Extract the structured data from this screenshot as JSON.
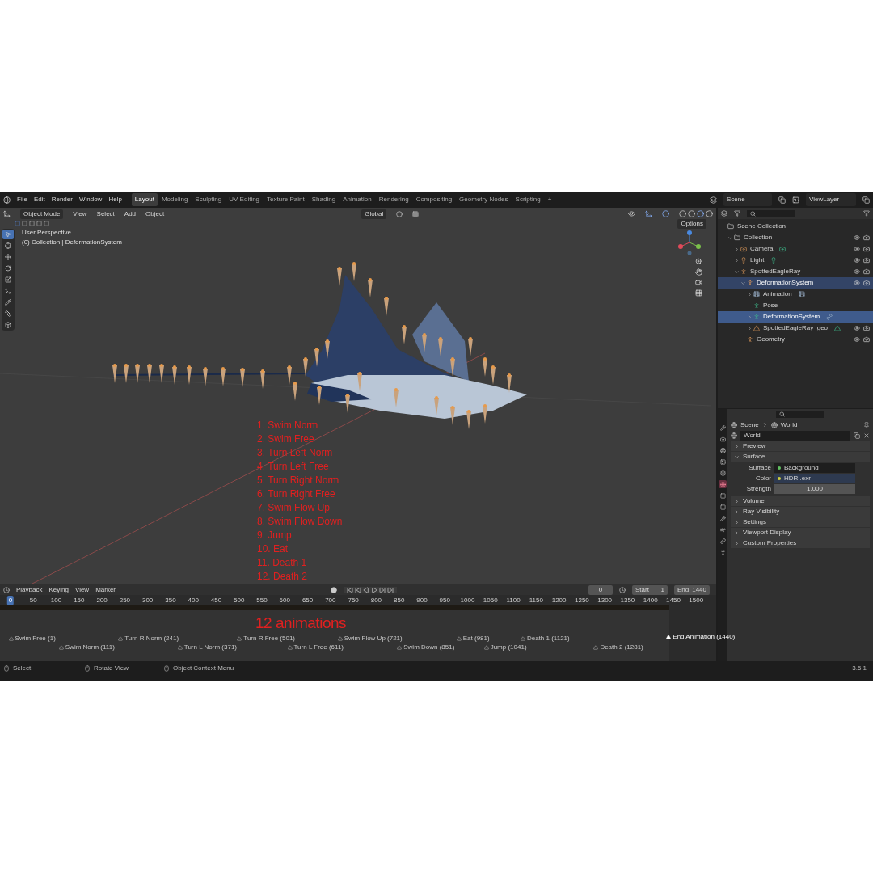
{
  "top_bar": {
    "menus": [
      "File",
      "Edit",
      "Render",
      "Window",
      "Help"
    ],
    "workspace_tabs": [
      {
        "label": "Layout",
        "selected": true
      },
      {
        "label": "Modeling",
        "selected": false
      },
      {
        "label": "Sculpting",
        "selected": false
      },
      {
        "label": "UV Editing",
        "selected": false
      },
      {
        "label": "Texture Paint",
        "selected": false
      },
      {
        "label": "Shading",
        "selected": false
      },
      {
        "label": "Animation",
        "selected": false
      },
      {
        "label": "Rendering",
        "selected": false
      },
      {
        "label": "Compositing",
        "selected": false
      },
      {
        "label": "Geometry Nodes",
        "selected": false
      },
      {
        "label": "Scripting",
        "selected": false
      }
    ],
    "add_tab": "+",
    "scene": "Scene",
    "view_layer": "ViewLayer"
  },
  "viewport": {
    "mode": "Object Mode",
    "menus": [
      "View",
      "Select",
      "Add",
      "Object"
    ],
    "orientation": "Global",
    "options": "Options",
    "overlay_title": "User Perspective",
    "overlay_subtitle": "(0) Collection | DeformationSystem",
    "tools": [
      {
        "kind": "select",
        "selected": true
      },
      {
        "kind": "cursor",
        "selected": false
      },
      {
        "kind": "move",
        "selected": false
      },
      {
        "kind": "rotate",
        "selected": false
      },
      {
        "kind": "scale",
        "selected": false
      },
      {
        "kind": "transform",
        "selected": false
      },
      {
        "kind": "annotate",
        "selected": false
      },
      {
        "kind": "measure",
        "selected": false
      },
      {
        "kind": "add-cube",
        "selected": false
      }
    ],
    "annotation_list": [
      "1. Swim Norm",
      "2. Swim Free",
      "3. Turn Left Norm",
      "4. Turn Left Free",
      "5. Turn Right Norm",
      "6. Turn Right Free",
      "7. Swim Flow Up",
      "8. Swim Flow Down",
      "9. Jump",
      "10. Eat",
      "11. Death 1",
      "12. Death 2"
    ]
  },
  "outliner": {
    "items": [
      {
        "label": "Scene Collection",
        "kind": "scene-collection",
        "selected": false,
        "children": [
          {
            "label": "Collection",
            "kind": "collection",
            "selected": false,
            "expanded": true,
            "visible": true,
            "children": [
              {
                "label": "Camera",
                "kind": "camera",
                "selected": false,
                "expanded": false,
                "visible": true
              },
              {
                "label": "Light",
                "kind": "light",
                "selected": false,
                "expanded": false,
                "visible": true
              },
              {
                "label": "SpottedEagleRay",
                "kind": "armature",
                "selected": false,
                "expanded": true,
                "visible": true,
                "children": [
                  {
                    "label": "DeformationSystem",
                    "kind": "armature",
                    "selected": true,
                    "expanded": true,
                    "visible": true,
                    "children": [
                      {
                        "label": "Animation",
                        "kind": "animation",
                        "selected": false,
                        "expanded": false
                      },
                      {
                        "label": "Pose",
                        "kind": "pose",
                        "selected": false
                      },
                      {
                        "label": "DeformationSystem",
                        "kind": "armature-data",
                        "selected": true,
                        "active": true,
                        "expanded": false
                      },
                      {
                        "label": "SpottedEagleRay_geo",
                        "kind": "mesh",
                        "selected": false,
                        "expanded": false,
                        "visible": true
                      }
                    ]
                  },
                  {
                    "label": "Geometry",
                    "kind": "armature",
                    "selected": false,
                    "visible": true
                  }
                ]
              }
            ]
          }
        ]
      }
    ]
  },
  "properties": {
    "tabs": [
      {
        "kind": "tool",
        "selected": false
      },
      {
        "kind": "render",
        "selected": false
      },
      {
        "kind": "output",
        "selected": false
      },
      {
        "kind": "view-layer",
        "selected": false
      },
      {
        "kind": "scene",
        "selected": false
      },
      {
        "kind": "world",
        "selected": true
      },
      {
        "kind": "collection",
        "selected": false
      },
      {
        "kind": "object",
        "selected": false
      },
      {
        "kind": "modifiers",
        "selected": false
      },
      {
        "kind": "physics",
        "selected": false
      },
      {
        "kind": "constraints",
        "selected": false
      },
      {
        "kind": "data",
        "selected": false
      }
    ],
    "breadcrumb": [
      "Scene",
      "World"
    ],
    "world_name": "World",
    "panels": [
      {
        "label": "Preview",
        "expanded": false
      },
      {
        "label": "Surface",
        "expanded": true,
        "fields": [
          {
            "label": "Surface",
            "value": "Background",
            "kind": "link"
          },
          {
            "label": "Color",
            "value": "HDRI.exr",
            "kind": "texture"
          },
          {
            "label": "Strength",
            "value": "1.000",
            "kind": "number"
          }
        ]
      },
      {
        "label": "Volume",
        "expanded": false
      },
      {
        "label": "Ray Visibility",
        "expanded": false
      },
      {
        "label": "Settings",
        "expanded": false
      },
      {
        "label": "Viewport Display",
        "expanded": false
      },
      {
        "label": "Custom Properties",
        "expanded": false
      }
    ]
  },
  "timeline": {
    "menus": [
      "Playback",
      "Keying",
      "View",
      "Marker"
    ],
    "current_frame": "0",
    "start_label": "Start",
    "start": "1",
    "end_label": "End",
    "end": "1440",
    "ruler": [
      {
        "label": "0",
        "selected": true
      },
      {
        "label": "50",
        "selected": false
      },
      {
        "label": "100",
        "selected": false
      },
      {
        "label": "150",
        "selected": false
      },
      {
        "label": "200",
        "selected": false
      },
      {
        "label": "250",
        "selected": false
      },
      {
        "label": "300",
        "selected": false
      },
      {
        "label": "350",
        "selected": false
      },
      {
        "label": "400",
        "selected": false
      },
      {
        "label": "450",
        "selected": false
      },
      {
        "label": "500",
        "selected": false
      },
      {
        "label": "550",
        "selected": false
      },
      {
        "label": "600",
        "selected": false
      },
      {
        "label": "650",
        "selected": false
      },
      {
        "label": "700",
        "selected": false
      },
      {
        "label": "750",
        "selected": false
      },
      {
        "label": "800",
        "selected": false
      },
      {
        "label": "850",
        "selected": false
      },
      {
        "label": "900",
        "selected": false
      },
      {
        "label": "950",
        "selected": false
      },
      {
        "label": "1000",
        "selected": false
      },
      {
        "label": "1050",
        "selected": false
      },
      {
        "label": "1100",
        "selected": false
      },
      {
        "label": "1150",
        "selected": false
      },
      {
        "label": "1200",
        "selected": false
      },
      {
        "label": "1250",
        "selected": false
      },
      {
        "label": "1300",
        "selected": false
      },
      {
        "label": "1350",
        "selected": false
      },
      {
        "label": "1400",
        "selected": false
      },
      {
        "label": "1450",
        "selected": false
      },
      {
        "label": "1500",
        "selected": false
      }
    ],
    "annotation": "12 animations",
    "markers": [
      {
        "label": "Swim Free (1)",
        "selected": false
      },
      {
        "label": "Swim Norm (111)",
        "selected": false
      },
      {
        "label": "Turn R Norm (241)",
        "selected": false
      },
      {
        "label": "Turn L Norm (371)",
        "selected": false
      },
      {
        "label": "Turn R Free (501)",
        "selected": false
      },
      {
        "label": "Turn L Free (611)",
        "selected": false
      },
      {
        "label": "Swim Flow Up (721)",
        "selected": false
      },
      {
        "label": "Swim Down (851)",
        "selected": false
      },
      {
        "label": "Eat (981)",
        "selected": false
      },
      {
        "label": "Jump (1041)",
        "selected": false
      },
      {
        "label": "Death 1 (1121)",
        "selected": false
      },
      {
        "label": "Death 2 (1281)",
        "selected": false
      },
      {
        "label": "End Animation (1440)",
        "selected": true
      }
    ]
  },
  "status_bar": {
    "hints": [
      "Select",
      "Rotate View",
      "Object Context Menu"
    ],
    "version": "3.5.1"
  }
}
